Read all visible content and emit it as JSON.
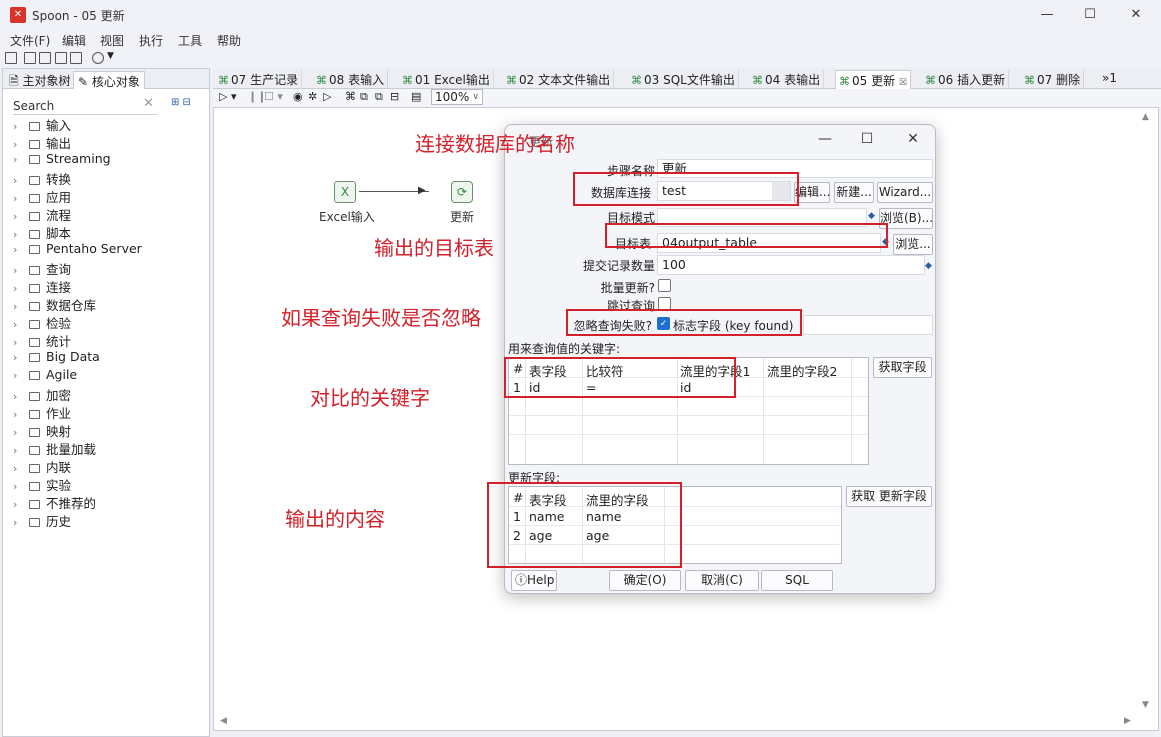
{
  "window": {
    "title": "Spoon - 05 更新",
    "app_icon": "spoon-icon",
    "minimize": "—",
    "maximize": "☐",
    "close": "✕"
  },
  "menu": [
    "文件(F)",
    "编辑",
    "视图",
    "执行",
    "工具",
    "帮助"
  ],
  "left_panel": {
    "tabs": [
      "主对象树",
      "核心对象"
    ],
    "active_tab": "核心对象",
    "search_placeholder": "Search",
    "tree": [
      "输入",
      "输出",
      "Streaming",
      "转换",
      "应用",
      "流程",
      "脚本",
      "Pentaho Server",
      "查询",
      "连接",
      "数据仓库",
      "检验",
      "统计",
      "Big Data",
      "Agile",
      "加密",
      "作业",
      "映射",
      "批量加载",
      "内联",
      "实验",
      "不推荐的",
      "历史"
    ]
  },
  "editor_tabs": [
    "07 生产记录",
    "08 表输入",
    "01 Excel输出",
    "02 文本文件输出",
    "03 SQL文件输出",
    "04 表输出",
    "05 更新",
    "06 插入更新",
    "07 删除"
  ],
  "active_editor_tab": "05 更新",
  "tab_overflow": "»1",
  "zoom": "100%",
  "canvas": {
    "steps": [
      {
        "label": "Excel输入",
        "icon": "excel-input-icon"
      },
      {
        "label": "更新",
        "icon": "update-icon"
      }
    ]
  },
  "dialog": {
    "title": "更新",
    "step_name_label": "步骤名称",
    "step_name_value": "更新",
    "connection_label": "数据库连接",
    "connection_value": "test",
    "edit_button": "编辑...",
    "new_button": "新建...",
    "wizard_button": "Wizard...",
    "schema_label": "目标模式",
    "schema_value": "",
    "browse_schema_button": "浏览(B)...",
    "table_label": "目标表",
    "table_value": "04output_table",
    "browse_table_button": "浏览...",
    "commit_label": "提交记录数量",
    "commit_value": "100",
    "batch_label": "批量更新?",
    "batch_checked": false,
    "skip_lookup_label": "跳过查询",
    "skip_lookup_checked": false,
    "ignore_fail_label": "忽略查询失败?",
    "ignore_fail_checked": true,
    "flag_field_label": "标志字段 (key found)",
    "flag_field_value": "",
    "key_section_label": "用来查询值的关键字:",
    "key_columns": [
      "#",
      "表字段",
      "比较符",
      "流里的字段1",
      "流里的字段2"
    ],
    "key_rows": [
      [
        "1",
        "id",
        "=",
        "id",
        ""
      ]
    ],
    "get_fields_button": "获取字段",
    "update_section_label": "更新字段:",
    "update_columns": [
      "#",
      "表字段",
      "流里的字段"
    ],
    "update_rows": [
      [
        "1",
        "name",
        "name"
      ],
      [
        "2",
        "age",
        "age"
      ]
    ],
    "get_update_fields_button": "获取 更新字段",
    "help_button": "Help",
    "ok_button": "确定(O)",
    "cancel_button": "取消(C)",
    "sql_button": "SQL"
  },
  "annotations": {
    "db_name": "连接数据库的名称",
    "target_table": "输出的目标表",
    "ignore_fail": "如果查询失败是否忽略",
    "key_compare": "对比的关键字",
    "output_content": "输出的内容"
  },
  "colors": {
    "annotation": "#d3202a",
    "accent": "#1f6fd0",
    "step_green": "#2e8b3a"
  }
}
